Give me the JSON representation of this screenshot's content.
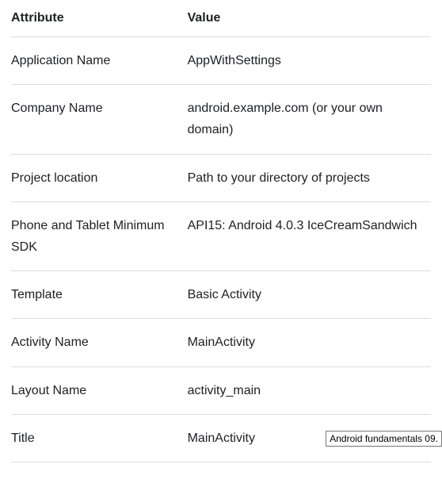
{
  "table": {
    "headers": {
      "attribute": "Attribute",
      "value": "Value"
    },
    "rows": [
      {
        "attribute": "Application Name",
        "value": "AppWithSettings"
      },
      {
        "attribute": "Company Name",
        "value": "android.example.com (or your own domain)"
      },
      {
        "attribute": "Project location",
        "value": "Path to your directory of projects"
      },
      {
        "attribute": "Phone and Tablet Minimum SDK",
        "value": "API15: Android 4.0.3 IceCreamSandwich"
      },
      {
        "attribute": "Template",
        "value": "Basic Activity"
      },
      {
        "attribute": "Activity Name",
        "value": "MainActivity"
      },
      {
        "attribute": "Layout Name",
        "value": "activity_main"
      },
      {
        "attribute": "Title",
        "value": "MainActivity"
      }
    ]
  },
  "tooltip": "Android fundamentals 09."
}
